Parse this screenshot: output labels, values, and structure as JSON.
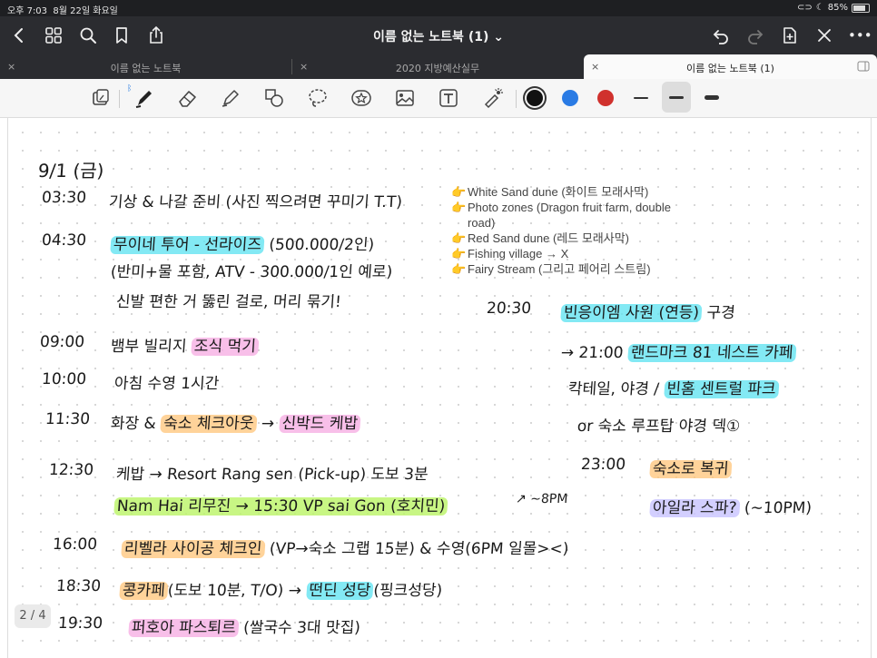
{
  "status": {
    "time": "오후 7:03",
    "date": "8월 22일 화요일",
    "battery": "85%"
  },
  "nav": {
    "title": "이름 없는 노트북 (1)",
    "chevron": "⌄",
    "more": "•••"
  },
  "tabs": [
    {
      "label": "이름 없는 노트북",
      "close": "×"
    },
    {
      "label": "2020 지방예산실무",
      "close": "×"
    },
    {
      "label": "이름 없는 노트북 (1)",
      "close": "×"
    }
  ],
  "toolbar": {
    "bluetooth": "ᛒ",
    "colors": [
      "#111111",
      "#2a7be4",
      "#d0312d"
    ]
  },
  "note": {
    "heading": "9/1 (금)",
    "rows": [
      {
        "time": "03:30",
        "parts": [
          {
            "t": "기상 & 나갈 준비 (사진 찍으려면 꾸미기 T.T)"
          }
        ]
      },
      {
        "time": "04:30",
        "parts": [
          {
            "t": "무이네 투어 - 선라이즈",
            "hl": "cyan"
          },
          {
            "t": " (500.000/2인)"
          }
        ]
      },
      {
        "time": "",
        "parts": [
          {
            "t": "(반미+물 포함, ATV - 300.000/1인 예로)"
          }
        ]
      },
      {
        "time": "",
        "parts": [
          {
            "t": "신발 편한 거 뚫린 걸로, 머리 묶기!"
          }
        ]
      },
      {
        "time": "09:00",
        "parts": [
          {
            "t": "뱀부 빌리지 "
          },
          {
            "t": "조식 먹기",
            "hl": "pink"
          }
        ]
      },
      {
        "time": "10:00",
        "parts": [
          {
            "t": "아침 수영 1시간"
          }
        ]
      },
      {
        "time": "11:30",
        "parts": [
          {
            "t": "화장 & "
          },
          {
            "t": "숙소 체크아웃",
            "hl": "orange"
          },
          {
            "t": " → "
          },
          {
            "t": "신박드 케밥",
            "hl": "pink"
          }
        ]
      },
      {
        "time": "12:30",
        "parts": [
          {
            "t": "케밥 → Resort Rang sen (Pick-up) 도보 3분"
          }
        ]
      },
      {
        "time": "",
        "parts": [
          {
            "t": "Nam Hai 리무진 → 15:30 VP sai Gon (호치민)",
            "hl": "green"
          }
        ]
      },
      {
        "time": "16:00",
        "parts": [
          {
            "t": "리벨라 사이공 체크인",
            "hl": "orange"
          },
          {
            "t": " (VP→숙소 그랩 15분) & 수영(6PM 일몰><)"
          }
        ]
      },
      {
        "time": "18:30",
        "parts": [
          {
            "t": "콩카페",
            "hl": "orange"
          },
          {
            "t": "(도보 10분, T/O) → "
          },
          {
            "t": "떤딘 성당",
            "hl": "cyan"
          },
          {
            "t": "(핑크성당)"
          }
        ]
      },
      {
        "time": "19:30",
        "parts": [
          {
            "t": "퍼호아 파스퇴르",
            "hl": "pink"
          },
          {
            "t": " (쌀국수 3대 맛집)"
          }
        ]
      }
    ],
    "side": [
      {
        "time": "20:30",
        "parts": [
          {
            "t": "빈응이엠 사원 (연등)",
            "hl": "cyan"
          },
          {
            "t": " 구경"
          }
        ]
      },
      {
        "time": "",
        "parts": [
          {
            "t": "→ 21:00 "
          },
          {
            "t": "랜드마크 81 네스트 카페",
            "hl": "cyan"
          }
        ]
      },
      {
        "time": "",
        "parts": [
          {
            "t": "칵테일, 야경 / "
          },
          {
            "t": "빈홈 센트럴 파크",
            "hl": "cyan"
          }
        ]
      },
      {
        "time": "",
        "parts": [
          {
            "t": "or 숙소 루프탑 야경 덱①"
          }
        ]
      },
      {
        "time": "23:00",
        "parts": [
          {
            "t": "숙소로 복귀",
            "hl": "orange"
          }
        ]
      },
      {
        "time": "",
        "parts": [
          {
            "t": "아일라 스파?",
            "hl": "purple"
          },
          {
            "t": " (~10PM)"
          }
        ]
      }
    ],
    "pm_note": "↗ ~8PM",
    "typed": [
      {
        "pointer": "👉",
        "text": "White Sand dune (화이트 모래사막)"
      },
      {
        "pointer": "👉",
        "text": "Photo zones (Dragon fruit farm, double road)"
      },
      {
        "pointer": "👉",
        "text": "Red Sand dune (레드 모래사막)"
      },
      {
        "pointer": "👉",
        "text": "Fishing village → X"
      },
      {
        "pointer": "👉",
        "text": "Fairy Stream (그리고 페어리 스트림)"
      }
    ]
  },
  "pagination": {
    "label": "2 / 4"
  }
}
